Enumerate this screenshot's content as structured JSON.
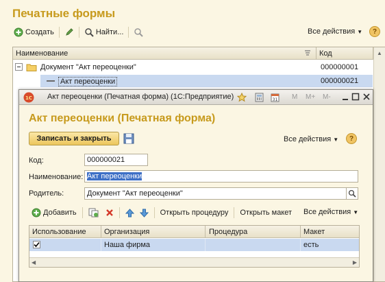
{
  "main": {
    "title": "Печатные формы",
    "toolbar": {
      "create_label": "Создать",
      "find_label": "Найти...",
      "all_actions_label": "Все действия",
      "help_label": "?"
    },
    "columns": [
      "Наименование",
      "Код"
    ],
    "rows": [
      {
        "name": "Документ \"Акт переоценки\"",
        "code": "000000001",
        "type": "folder",
        "expanded": true
      },
      {
        "name": "Акт переоценки",
        "code": "000000021",
        "type": "item",
        "selected": true
      }
    ]
  },
  "dialog": {
    "window_title": "Акт переоценки (Печатная форма)  (1С:Предприятие)",
    "window_buttons": [
      "M",
      "M+",
      "M-"
    ],
    "heading": "Акт переоценки (Печатная форма)",
    "save_close_label": "Записать и закрыть",
    "all_actions_label": "Все действия",
    "help_label": "?",
    "fields": {
      "code_label": "Код:",
      "code_value": "000000021",
      "name_label": "Наименование:",
      "name_value": "Акт переоценки",
      "parent_label": "Родитель:",
      "parent_value": "Документ \"Акт переоценки\""
    },
    "table_toolbar": {
      "add_label": "Добавить",
      "open_procedure_label": "Открыть процедуру",
      "open_layout_label": "Открыть макет",
      "all_actions_label": "Все действия"
    },
    "table": {
      "columns": [
        "Использование",
        "Организация",
        "Процедура",
        "Макет"
      ],
      "rows": [
        {
          "usage_checked": true,
          "organization": "Наша фирма",
          "procedure": "",
          "layout": "есть"
        }
      ]
    }
  },
  "colors": {
    "title_gold": "#c79a1c",
    "selection_blue": "#c9d9f0",
    "background": "#fbf6e3"
  }
}
